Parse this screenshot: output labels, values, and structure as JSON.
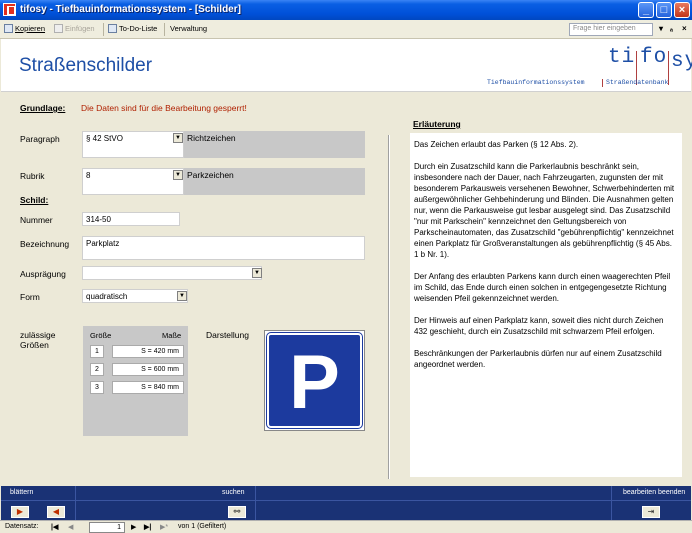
{
  "window": {
    "title": "tifosy - Tiefbauinformationssystem - [Schilder]"
  },
  "toolbar": {
    "copy_label": "Kopieren",
    "paste_label": "Einfügen",
    "todo_label": "To-Do-Liste",
    "admin_label": "Verwaltung",
    "help_placeholder": "Frage hier eingeben"
  },
  "header": {
    "page_title": "Straßenschilder",
    "logo_left": "ti",
    "logo_mid": "fo",
    "logo_right": "sy",
    "logo_sub_left": "Tiefbauinformationssystem",
    "logo_sub_right": "Straßendatenbank"
  },
  "form": {
    "grundlage_label": "Grundlage:",
    "grundlage_text": "Die Daten sind für die Bearbeitung gesperrt!",
    "paragraph_label": "Paragraph",
    "paragraph_value": "§ 42 StVO",
    "paragraph_desc": "Richtzeichen",
    "rubrik_label": "Rubrik",
    "rubrik_value": "8",
    "rubrik_desc": "Parkzeichen",
    "schild_label": "Schild:",
    "nummer_label": "Nummer",
    "nummer_value": "314-50",
    "bezeichnung_label": "Bezeichnung",
    "bezeichnung_value": "Parkplatz",
    "auspraegung_label": "Ausprägung",
    "auspraegung_value": "",
    "form_label": "Form",
    "form_value": "quadratisch",
    "sizes_label_1": "zulässige",
    "sizes_label_2": "Größen",
    "sizes_col_size": "Größe",
    "sizes_col_measure": "Maße",
    "sizes": [
      {
        "num": "1",
        "measure": "S = 420 mm"
      },
      {
        "num": "2",
        "measure": "S = 600 mm"
      },
      {
        "num": "3",
        "measure": "S = 840 mm"
      }
    ],
    "display_label": "Darstellung",
    "sign_letter": "P"
  },
  "explanation": {
    "title": "Erläuterung",
    "paragraphs": [
      "Das Zeichen erlaubt das Parken (§ 12 Abs. 2).",
      "Durch ein Zusatzschild kann die Parkerlaubnis beschränkt sein, insbesondere nach der Dauer, nach Fahrzeugarten, zugunsten der mit besonderem Parkausweis versehenen Bewohner, Schwerbehinderten mit außergewöhnlicher Gehbehinderung und Blinden. Die Ausnahmen gelten nur, wenn die Parkausweise gut lesbar ausgelegt sind. Das Zusatzschild \"nur mit Parkschein\" kennzeichnet den Geltungsbereich von Parkscheinautomaten, das Zusatzschild \"gebührenpflichtig\" kennzeichnet einen Parkplatz für Großveranstaltungen als gebührenpflichtig (§ 45 Abs. 1 b Nr. 1).",
      "Der Anfang des erlaubten Parkens kann durch einen waagerechten Pfeil im Schild, das Ende durch einen solchen in entgegengesetzte Richtung weisenden Pfeil gekennzeichnet werden.",
      "Der Hinweis auf einen Parkplatz kann, soweit dies nicht durch Zeichen 432 geschieht, durch ein Zusatzschild mit schwarzem Pfeil erfolgen.",
      "Beschränkungen der Parkerlaubnis dürfen nur auf einem Zusatzschild angeordnet werden."
    ]
  },
  "navband": {
    "browse_label": "blättern",
    "search_label": "suchen",
    "exit_label": "bearbeiten beenden"
  },
  "statusbar": {
    "record_label": "Datensatz:",
    "record_value": "1",
    "record_total": "von 1 (Gefiltert)"
  }
}
